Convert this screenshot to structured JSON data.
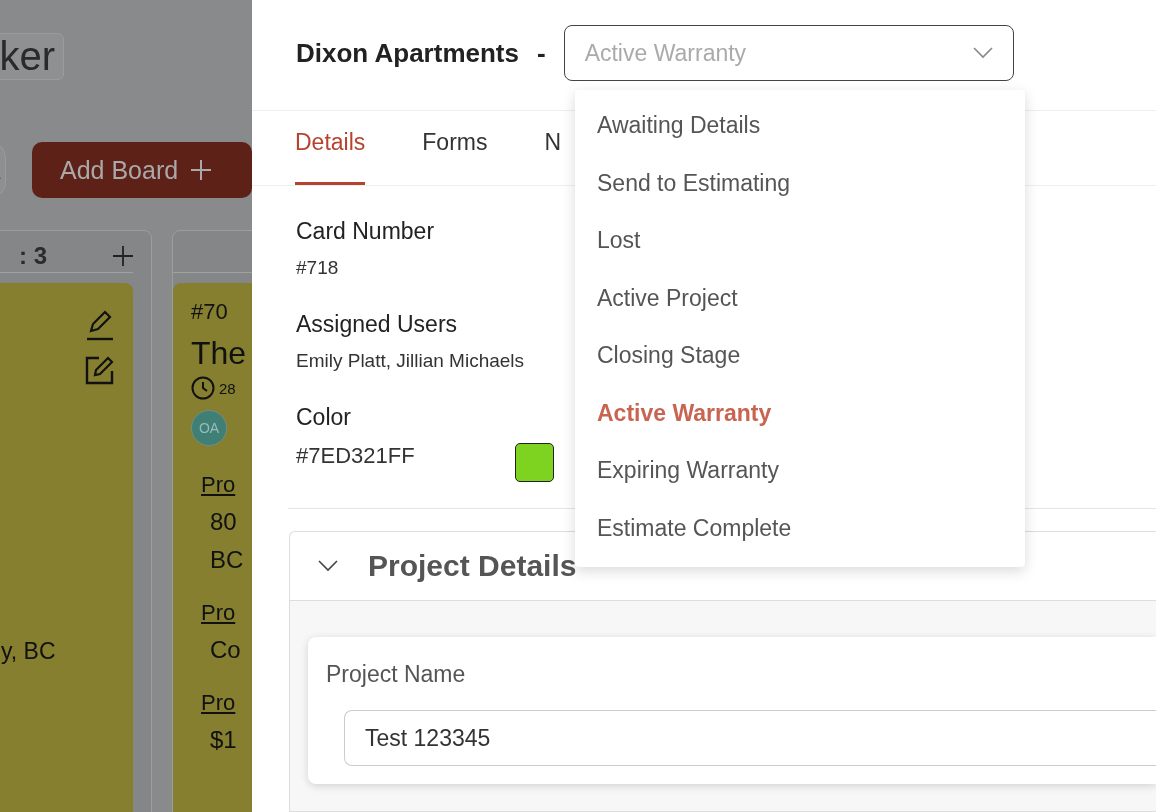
{
  "board": {
    "title": "ker",
    "add_button": "Add Board",
    "columns": [
      {
        "header": ": 3",
        "cards": [
          {
            "kind": "partial",
            "address": "y, BC"
          }
        ]
      },
      {
        "cards": [
          {
            "kind": "full",
            "number": "#70",
            "title": "The",
            "date": "28",
            "avatar": "OA",
            "fields": [
              {
                "label": "Pro",
                "values": [
                  "80",
                  "BC"
                ]
              },
              {
                "label": "Pro",
                "values": [
                  "Co"
                ]
              },
              {
                "label": "Pro",
                "values": [
                  "$1"
                ]
              }
            ]
          }
        ]
      }
    ]
  },
  "panel": {
    "title": "Dixon Apartments",
    "separator": "-",
    "status": {
      "value": "Active Warranty",
      "expanded": true,
      "options": [
        {
          "label": "Awaiting Details",
          "selected": false
        },
        {
          "label": "Send to Estimating",
          "selected": false
        },
        {
          "label": "Lost",
          "selected": false
        },
        {
          "label": "Active Project",
          "selected": false
        },
        {
          "label": "Closing Stage",
          "selected": false
        },
        {
          "label": "Active Warranty",
          "selected": true
        },
        {
          "label": "Expiring Warranty",
          "selected": false
        },
        {
          "label": "Estimate Complete",
          "selected": false
        }
      ]
    },
    "tabs": [
      {
        "label": "Details",
        "selected": true
      },
      {
        "label": "Forms",
        "selected": false
      },
      {
        "label": "N",
        "selected": false
      }
    ],
    "fields": [
      {
        "kind": "text",
        "label": "Card Number",
        "value": "#718"
      },
      {
        "kind": "text",
        "label": "Assigned Users",
        "value": "Emily Platt, Jillian Michaels"
      },
      {
        "kind": "color",
        "label": "Color",
        "value": "#7ED321FF"
      }
    ],
    "section": {
      "title": "Project Details",
      "expanded": true,
      "fields": [
        {
          "label": "Project Name",
          "value": "Test 123345"
        }
      ]
    }
  }
}
